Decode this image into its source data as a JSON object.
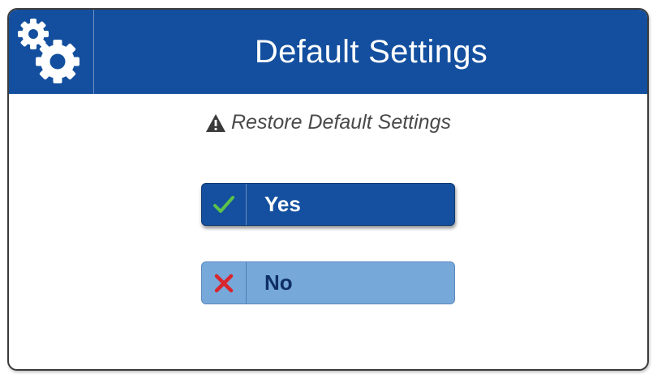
{
  "header": {
    "title": "Default Settings",
    "icon": "gears-icon"
  },
  "prompt": {
    "icon": "warning-icon",
    "text": "Restore Default Settings"
  },
  "buttons": {
    "yes": {
      "label": "Yes",
      "icon": "checkmark-icon",
      "icon_color": "#5cc24a"
    },
    "no": {
      "label": "No",
      "icon": "x-mark-icon",
      "icon_color": "#d8262e"
    }
  },
  "colors": {
    "header_bg": "#134f9e",
    "yes_bg": "#14509f",
    "no_bg": "#76a8da"
  }
}
